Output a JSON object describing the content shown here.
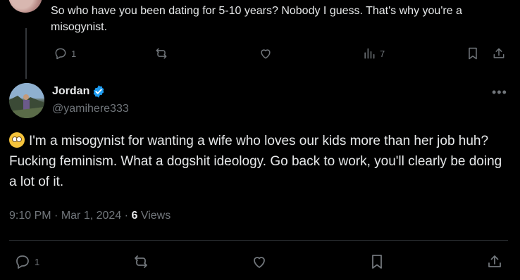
{
  "reply": {
    "text": "So who have you been dating for 5-10 years? Nobody I guess. That's why you're a misogynist.",
    "replies_count": "1",
    "views_count": "7"
  },
  "tweet": {
    "author_name": "Jordan",
    "author_handle": "@yamihere333",
    "text": "I'm a misogynist for wanting a wife who loves our kids more than her job huh? Fucking feminism. What a dogshit ideology. Go back to work, you'll clearly be doing a lot of it.",
    "emoji": "face-with-rolling-eyes",
    "time": "9:10 PM",
    "date": "Mar 1, 2024",
    "views_count": "6",
    "views_label": "Views",
    "replies_count": "1"
  },
  "colors": {
    "background": "#000000",
    "text": "#e7e9ea",
    "muted": "#71767b",
    "verified": "#1d9bf0"
  }
}
